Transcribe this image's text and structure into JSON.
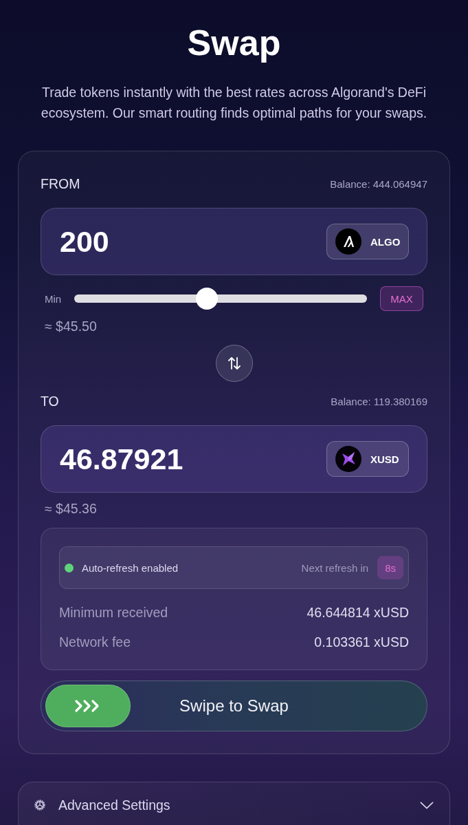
{
  "header": {
    "title": "Swap",
    "subtitle": "Trade tokens instantly with the best rates across Algorand's DeFi ecosystem. Our smart routing finds optimal paths for your swaps."
  },
  "from": {
    "label": "FROM",
    "balance": "Balance: 444.064947",
    "amount": "200",
    "token": {
      "symbol": "ALGO",
      "kind": "lambda"
    },
    "slider": {
      "min_label": "Min",
      "level": 0.45,
      "max_label": "MAX"
    },
    "usd_value": "≈ $45.50"
  },
  "to": {
    "label": "TO",
    "balance": "Balance: 119.380169",
    "amount": "46.87921",
    "token": {
      "symbol": "XUSD",
      "kind": "star"
    },
    "usd_value": "≈ $45.36"
  },
  "details": {
    "auto_refresh": {
      "enabled": true,
      "label": "Auto-refresh enabled",
      "next_label": "Next refresh in",
      "countdown": "8s"
    },
    "rows": [
      {
        "label": "Minimum received",
        "value": "46.644814 xUSD"
      },
      {
        "label": "Network fee",
        "value": "0.103361 xUSD"
      }
    ]
  },
  "swipe": {
    "label": "Swipe to Swap"
  },
  "advanced_settings": {
    "label": "Advanced Settings",
    "expanded": false
  }
}
